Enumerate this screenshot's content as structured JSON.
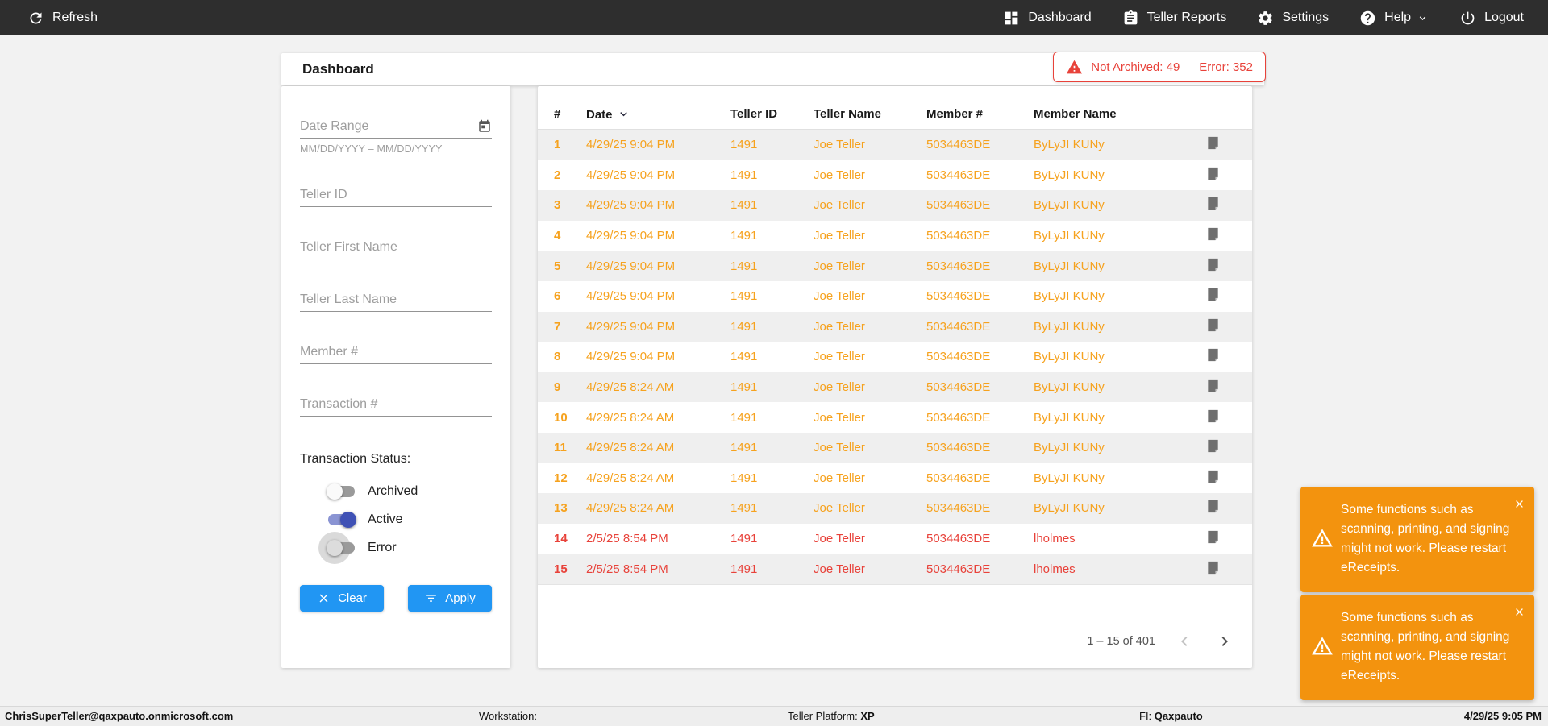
{
  "nav": {
    "refresh_label": "Refresh",
    "items": [
      {
        "label": "Dashboard",
        "icon": "dashboard-icon"
      },
      {
        "label": "Teller Reports",
        "icon": "clipboard-icon"
      },
      {
        "label": "Settings",
        "icon": "gear-icon"
      },
      {
        "label": "Help",
        "icon": "help-icon",
        "has_dropdown": true
      },
      {
        "label": "Logout",
        "icon": "power-icon"
      }
    ]
  },
  "header": {
    "title": "Dashboard",
    "alert": {
      "not_archived": "Not Archived: 49",
      "error": "Error: 352"
    }
  },
  "filters": {
    "date_range": {
      "label": "Date Range",
      "helper": "MM/DD/YYYY – MM/DD/YYYY",
      "value": ""
    },
    "fields": [
      {
        "label": "Teller ID",
        "value": ""
      },
      {
        "label": "Teller First Name",
        "value": ""
      },
      {
        "label": "Teller Last Name",
        "value": ""
      },
      {
        "label": "Member #",
        "value": ""
      },
      {
        "label": "Transaction #",
        "value": ""
      }
    ],
    "status_label": "Transaction Status:",
    "toggles": [
      {
        "label": "Archived",
        "on": false
      },
      {
        "label": "Active",
        "on": true
      },
      {
        "label": "Error",
        "on": false
      }
    ],
    "clear_label": "Clear",
    "apply_label": "Apply"
  },
  "table": {
    "columns": [
      "#",
      "Date",
      "Teller ID",
      "Teller Name",
      "Member #",
      "Member Name"
    ],
    "sorted_by": "Date",
    "sort_direction": "desc",
    "rows": [
      {
        "num": "1",
        "date": "4/29/25 9:04 PM",
        "teller_id": "1491",
        "teller_name": "Joe Teller",
        "member_num": "5034463DE",
        "member_name": "ByLyJI KUNy",
        "status": "active"
      },
      {
        "num": "2",
        "date": "4/29/25 9:04 PM",
        "teller_id": "1491",
        "teller_name": "Joe Teller",
        "member_num": "5034463DE",
        "member_name": "ByLyJI KUNy",
        "status": "active"
      },
      {
        "num": "3",
        "date": "4/29/25 9:04 PM",
        "teller_id": "1491",
        "teller_name": "Joe Teller",
        "member_num": "5034463DE",
        "member_name": "ByLyJI KUNy",
        "status": "active"
      },
      {
        "num": "4",
        "date": "4/29/25 9:04 PM",
        "teller_id": "1491",
        "teller_name": "Joe Teller",
        "member_num": "5034463DE",
        "member_name": "ByLyJI KUNy",
        "status": "active"
      },
      {
        "num": "5",
        "date": "4/29/25 9:04 PM",
        "teller_id": "1491",
        "teller_name": "Joe Teller",
        "member_num": "5034463DE",
        "member_name": "ByLyJI KUNy",
        "status": "active"
      },
      {
        "num": "6",
        "date": "4/29/25 9:04 PM",
        "teller_id": "1491",
        "teller_name": "Joe Teller",
        "member_num": "5034463DE",
        "member_name": "ByLyJI KUNy",
        "status": "active"
      },
      {
        "num": "7",
        "date": "4/29/25 9:04 PM",
        "teller_id": "1491",
        "teller_name": "Joe Teller",
        "member_num": "5034463DE",
        "member_name": "ByLyJI KUNy",
        "status": "active"
      },
      {
        "num": "8",
        "date": "4/29/25 9:04 PM",
        "teller_id": "1491",
        "teller_name": "Joe Teller",
        "member_num": "5034463DE",
        "member_name": "ByLyJI KUNy",
        "status": "active"
      },
      {
        "num": "9",
        "date": "4/29/25 8:24 AM",
        "teller_id": "1491",
        "teller_name": "Joe Teller",
        "member_num": "5034463DE",
        "member_name": "ByLyJI KUNy",
        "status": "active"
      },
      {
        "num": "10",
        "date": "4/29/25 8:24 AM",
        "teller_id": "1491",
        "teller_name": "Joe Teller",
        "member_num": "5034463DE",
        "member_name": "ByLyJI KUNy",
        "status": "active"
      },
      {
        "num": "11",
        "date": "4/29/25 8:24 AM",
        "teller_id": "1491",
        "teller_name": "Joe Teller",
        "member_num": "5034463DE",
        "member_name": "ByLyJI KUNy",
        "status": "active"
      },
      {
        "num": "12",
        "date": "4/29/25 8:24 AM",
        "teller_id": "1491",
        "teller_name": "Joe Teller",
        "member_num": "5034463DE",
        "member_name": "ByLyJI KUNy",
        "status": "active"
      },
      {
        "num": "13",
        "date": "4/29/25 8:24 AM",
        "teller_id": "1491",
        "teller_name": "Joe Teller",
        "member_num": "5034463DE",
        "member_name": "ByLyJI KUNy",
        "status": "active"
      },
      {
        "num": "14",
        "date": "2/5/25 8:54 PM",
        "teller_id": "1491",
        "teller_name": "Joe Teller",
        "member_num": "5034463DE",
        "member_name": "lholmes",
        "status": "error"
      },
      {
        "num": "15",
        "date": "2/5/25 8:54 PM",
        "teller_id": "1491",
        "teller_name": "Joe Teller",
        "member_num": "5034463DE",
        "member_name": "lholmes",
        "status": "error"
      }
    ]
  },
  "pagination": {
    "range_label": "1 – 15 of 401"
  },
  "toasts": [
    {
      "message": "Some functions such as scanning, printing, and signing might not work. Please restart eReceipts."
    },
    {
      "message": "Some functions such as scanning, printing, and signing might not work. Please restart eReceipts."
    }
  ],
  "statusbar": {
    "user": "ChrisSuperTeller@qaxpauto.onmicrosoft.com",
    "workstation_label": "Workstation:",
    "platform_label": "Teller Platform:",
    "platform_value": "XP",
    "fi_label": "FI:",
    "fi_value": "Qaxpauto",
    "datetime": "4/29/25 9:05 PM"
  },
  "colors": {
    "nav_bg": "#2e2e2e",
    "page_bg": "#f2f2f2",
    "row_active_text": "#f6a21e",
    "row_error_text": "#e8423a",
    "alert_red": "#e8423a",
    "button_blue": "#2196f3",
    "toggle_on_indigo": "#3f51b5",
    "toast_orange": "#f3930e",
    "row_stripe": "#efefef"
  }
}
